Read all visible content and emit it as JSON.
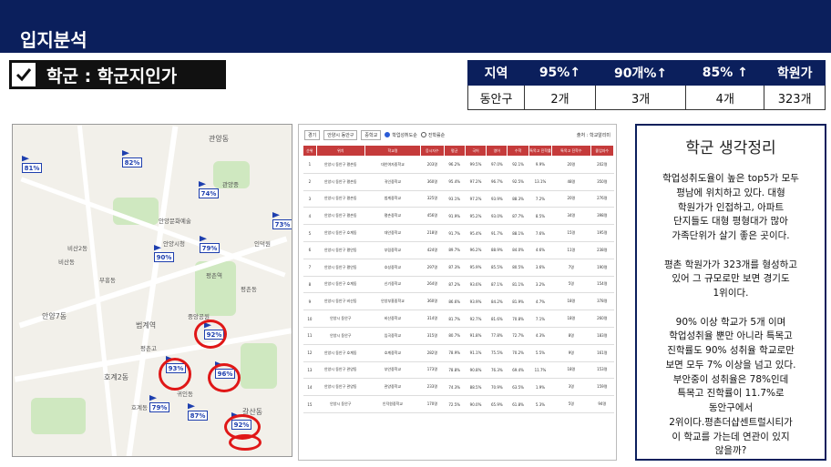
{
  "header": {
    "title": "입지분석"
  },
  "subtitle": {
    "text": "학군 : 학군지인가"
  },
  "stats": {
    "headers": [
      "지역",
      "95%↑",
      "90개%↑",
      "85% ↑",
      "학원가"
    ],
    "row": [
      "동안구",
      "2개",
      "3개",
      "4개",
      "323개"
    ]
  },
  "map": {
    "place_labels": [
      "관양동",
      "범계역",
      "평촌역",
      "안양7동",
      "호계2동",
      "평촌동",
      "비산동",
      "부흥동",
      "갈산동",
      "귀인동",
      "호계동",
      "안양시청",
      "중앙공원",
      "안양문화예술",
      "관양중",
      "인덕원",
      "비산2동",
      "평촌고"
    ],
    "pins": [
      "81%",
      "82%",
      "74%",
      "73%",
      "79%",
      "90%",
      "92%",
      "93%",
      "96%",
      "79%",
      "87%",
      "92%"
    ]
  },
  "school_table": {
    "toolbar": {
      "region": "경기",
      "district": "안양시 동안구",
      "level": "중학교",
      "opt1": "학업성취도순",
      "opt2": "진학률순",
      "source": "출처 : 학교알리미"
    },
    "headers": [
      "순위",
      "위치",
      "학교명",
      "응시자수",
      "평균",
      "국어",
      "영어",
      "수학",
      "특목고 진학률",
      "특목고 진학수",
      "졸업자수"
    ],
    "rows": [
      [
        "1",
        "안양시 동안구 평촌동",
        "대안여자중학교",
        "203명",
        "96.2%",
        "99.5%",
        "97.0%",
        "92.1%",
        "9.9%",
        "20명",
        "202명"
      ],
      [
        "2",
        "안양시 동안구 평촌동",
        "귀인중학교",
        "360명",
        "95.4%",
        "97.2%",
        "96.7%",
        "92.5%",
        "13.1%",
        "48명",
        "350명"
      ],
      [
        "3",
        "안양시 동안구 평촌동",
        "범계중학교",
        "325명",
        "93.1%",
        "97.2%",
        "93.9%",
        "88.3%",
        "7.2%",
        "20명",
        "276명"
      ],
      [
        "4",
        "안양시 동안구 평촌동",
        "평촌중학교",
        "456명",
        "91.9%",
        "95.2%",
        "93.0%",
        "87.7%",
        "8.5%",
        "34명",
        "398명"
      ],
      [
        "5",
        "안양시 동안구 호계동",
        "대안중학교",
        "218명",
        "91.7%",
        "95.4%",
        "91.7%",
        "88.1%",
        "7.6%",
        "15명",
        "195명"
      ],
      [
        "6",
        "안양시 동안구 평안동",
        "부림중학교",
        "424명",
        "89.7%",
        "96.2%",
        "88.9%",
        "84.0%",
        "4.6%",
        "11명",
        "238명"
      ],
      [
        "7",
        "안양시 동안구 평안동",
        "호성중학교",
        "297명",
        "87.3%",
        "95.9%",
        "85.5%",
        "80.5%",
        "3.6%",
        "7명",
        "190명"
      ],
      [
        "8",
        "안양시 동안구 호계동",
        "신기중학교",
        "264명",
        "87.2%",
        "93.6%",
        "87.1%",
        "81.1%",
        "3.2%",
        "5명",
        "154명"
      ],
      [
        "9",
        "안양시 동안구 비산동",
        "안양부흥중학교",
        "360명",
        "86.6%",
        "93.9%",
        "84.2%",
        "81.9%",
        "4.7%",
        "18명",
        "378명"
      ],
      [
        "10",
        "안양시 동안구",
        "비산중학교",
        "314명",
        "81.7%",
        "92.7%",
        "81.6%",
        "70.8%",
        "7.1%",
        "18명",
        "260명"
      ],
      [
        "11",
        "안양시 동안구",
        "임곡중학교",
        "315명",
        "80.7%",
        "91.8%",
        "77.8%",
        "72.7%",
        "4.3%",
        "8명",
        "183명"
      ],
      [
        "12",
        "안양시 동안구 호계동",
        "호계중학교",
        "282명",
        "78.9%",
        "91.1%",
        "75.5%",
        "70.2%",
        "5.5%",
        "9명",
        "161명"
      ],
      [
        "13",
        "안양시 동안구 관양동",
        "부안중학교",
        "173명",
        "78.8%",
        "90.8%",
        "76.3%",
        "69.4%",
        "11.7%",
        "18명",
        "153명"
      ],
      [
        "14",
        "안양시 동안구 관양동",
        "관양중학교",
        "233명",
        "74.3%",
        "88.5%",
        "70.9%",
        "63.5%",
        "1.9%",
        "3명",
        "159명"
      ],
      [
        "15",
        "안양시 동안구",
        "인덕원중학교",
        "170명",
        "72.5%",
        "90.0%",
        "65.9%",
        "61.8%",
        "5.3%",
        "5명",
        "94명"
      ]
    ]
  },
  "summary": {
    "title": "학군 생각정리",
    "body": "학업성취도율이 높은 top5가 모두\n평남에 위치하고 있다. 대형\n학원가가 인접하고, 아파트\n단지들도 대형 평형대가 많아\n가족단위가 살기 좋은 곳이다.\n\n평촌 학원가가 323개를 형성하고\n있어 그 규모로만 보면 경기도\n1위이다.\n\n90% 이상 학교가 5개 이며\n학업성취율 뿐만 아니라 특목고\n진학률도  90% 성취율 학교로만\n보면 모두 7% 이상을 넘고 있다.\n부안중이 성취율은 78%인데\n특목고 진학률이 11.7%로\n동안구에서\n2위이다.평촌더샵센트럴시티가\n이 학교를 가는데 연관이 있지\n않을까?"
  }
}
